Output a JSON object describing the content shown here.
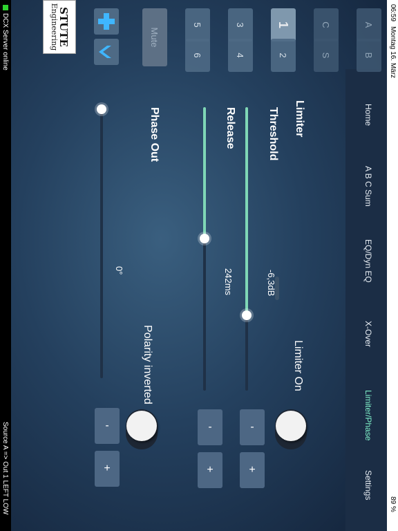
{
  "status": {
    "time": "06:59",
    "date": "Montag 16. März",
    "battery": "89 %",
    "bottom_left": "DCX Server online",
    "bottom_right": "Source A => Out 1 LEFT LOW"
  },
  "tabs": [
    {
      "label": "Home"
    },
    {
      "label": "A B C Sum"
    },
    {
      "label": "EQ/Dyn EQ"
    },
    {
      "label": "X-Over"
    },
    {
      "label": "Limiter/Phase",
      "active": true
    },
    {
      "label": "Settings"
    }
  ],
  "channels": {
    "inputs": [
      "A",
      "B",
      "C",
      "S"
    ],
    "outputs": [
      "1",
      "2",
      "3",
      "4",
      "5",
      "6"
    ],
    "selected": "1",
    "mute_label": "Mute"
  },
  "logo": {
    "line1": "STUTE",
    "line2": "Engineering"
  },
  "limiter": {
    "heading": "Limiter",
    "toggle_label": "Limiter On",
    "threshold_label": "Threshold",
    "threshold_value": "-6,3dB",
    "release_label": "Release",
    "release_value": "242ms",
    "minus": "-",
    "plus": "+"
  },
  "phase": {
    "heading": "Phase Out",
    "value": "0°",
    "polarity_label": "Polarity inverted",
    "minus": "-",
    "plus": "+"
  },
  "colors": {
    "accent": "#7fd7b6",
    "active_tab": "#7ff0c9"
  }
}
